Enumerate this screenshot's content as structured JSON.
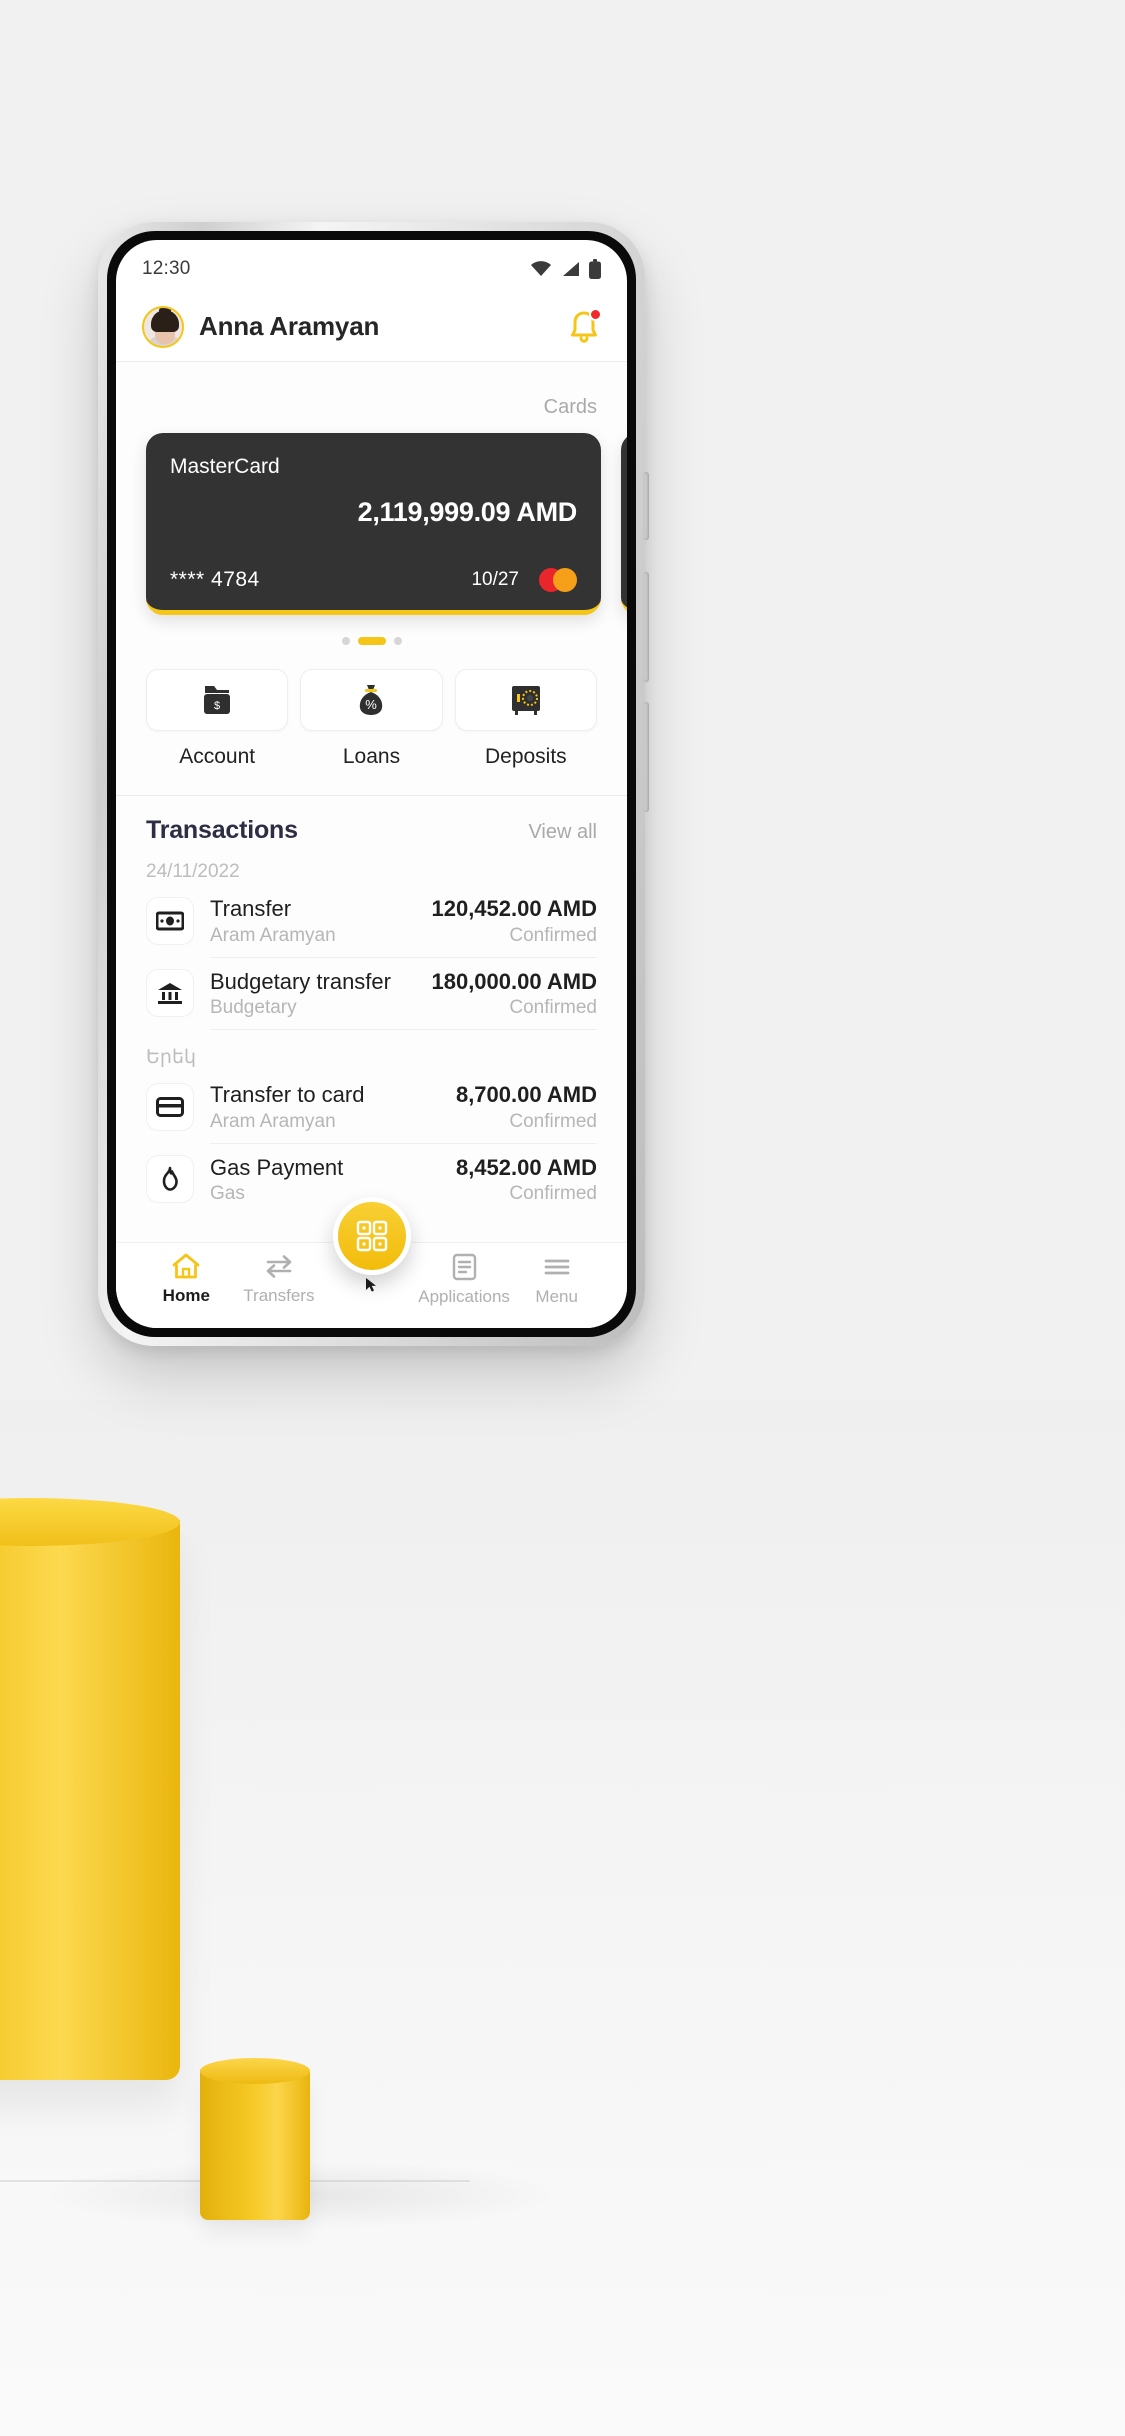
{
  "statusbar": {
    "time": "12:30",
    "icons": [
      "wifi-icon",
      "signal-icon",
      "battery-icon"
    ]
  },
  "header": {
    "user_name": "Anna Aramyan",
    "avatar_name": "user-avatar",
    "bell_icon": "notification-bell-icon",
    "bell_badge": true
  },
  "cards_section": {
    "label": "Cards",
    "cards": [
      {
        "brand": "MasterCard",
        "balance": "2,119,999.09 AMD",
        "number": "**** 4784",
        "expiry": "10/27",
        "network_logo": "mastercard-logo"
      }
    ],
    "pagination": {
      "total": 3,
      "active_index": 1
    }
  },
  "quick_actions": [
    {
      "label": "Account",
      "icon": "folder-dollar-icon"
    },
    {
      "label": "Loans",
      "icon": "money-bag-percent-icon"
    },
    {
      "label": "Deposits",
      "icon": "safe-vault-icon"
    }
  ],
  "transactions": {
    "title": "Transactions",
    "view_all": "View all",
    "groups": [
      {
        "date": "24/11/2022",
        "items": [
          {
            "icon": "banknote-icon",
            "name": "Transfer",
            "counterparty": "Aram Aramyan",
            "amount": "120,452.00 AMD",
            "status": "Confirmed"
          },
          {
            "icon": "bank-building-icon",
            "name": "Budgetary transfer",
            "counterparty": "Budgetary",
            "amount": "180,000.00 AMD",
            "status": "Confirmed"
          }
        ]
      },
      {
        "date": "Երեկ",
        "items": [
          {
            "icon": "credit-card-icon",
            "name": "Transfer to card",
            "counterparty": "Aram Aramyan",
            "amount": "8,700.00 AMD",
            "status": "Confirmed"
          },
          {
            "icon": "flame-gas-icon",
            "name": "Gas Payment",
            "counterparty": "Gas",
            "amount": "8,452.00 AMD",
            "status": "Confirmed"
          }
        ]
      }
    ]
  },
  "bottom_nav": {
    "items": [
      {
        "label": "Home",
        "icon": "home-icon",
        "active": true
      },
      {
        "label": "Transfers",
        "icon": "transfers-icon",
        "active": false
      },
      {
        "label": "Applications",
        "icon": "applications-icon",
        "active": false
      },
      {
        "label": "Menu",
        "icon": "menu-hamburger-icon",
        "active": false
      }
    ],
    "fab": {
      "icon": "qr-code-icon"
    }
  },
  "colors": {
    "accent": "#f5c518",
    "card_bg": "#333333",
    "text_primary": "#1f1f1f",
    "text_muted": "#b6b6b6",
    "badge_red": "#ef2b2b"
  }
}
